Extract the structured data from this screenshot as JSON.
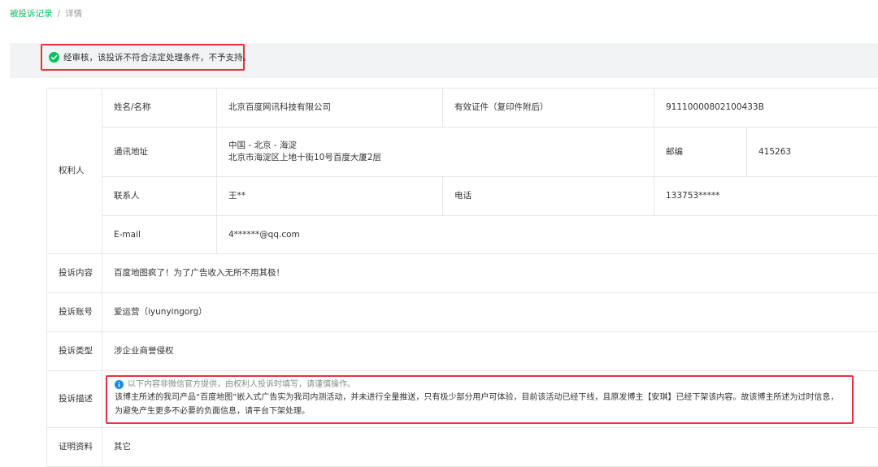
{
  "breadcrumb": {
    "parent": "被投诉记录",
    "separator": "/",
    "current": "详情"
  },
  "status": {
    "message": "经审核，该投诉不符合法定处理条件，不予支持。",
    "icon": "check-circle-icon",
    "color": "#07c160"
  },
  "rights_holder": {
    "section_label": "权利人",
    "name_label": "姓名/名称",
    "name_value": "北京百度网讯科技有限公司",
    "id_label": "有效证件（复印件附后）",
    "id_value": "91110000802100433B",
    "address_label": "通讯地址",
    "address_line1": "中国 - 北京 - 海淀",
    "address_line2": "北京市海淀区上地十街10号百度大厦2层",
    "postcode_label": "邮编",
    "postcode_value": "415263",
    "contact_label": "联系人",
    "contact_value": "王**",
    "phone_label": "电话",
    "phone_value": "133753*****",
    "email_label": "E-mail",
    "email_value": "4******@qq.com"
  },
  "complaint": {
    "content_label": "投诉内容",
    "content_value": "百度地图疯了！为了广告收入无所不用其极！",
    "account_label": "投诉账号",
    "account_value": "爱运营（iyunyingorg）",
    "type_label": "投诉类型",
    "type_value": "涉企业商誉侵权",
    "desc_label": "投诉描述",
    "desc_notice": "以下内容非微信官方提供，由权利人投诉时填写，请谨慎操作。",
    "desc_line1": "该博主所述的我司产品“百度地图”嵌入式广告实为我司内测活动，并未进行全量推送，只有极少部分用户可体验，目前该活动已经下线，且原发博主【安琪】已经下架该内容。故该博主所述为过时信息，",
    "desc_line2": "为避免产生更多不必要的负面信息，请平台下架处理。",
    "proof_label": "证明资料",
    "proof_value": "其它"
  },
  "colors": {
    "accent": "#07c160",
    "highlight_border": "#e8323c",
    "info": "#1e88e5",
    "status_bg": "#f2f3f5"
  }
}
